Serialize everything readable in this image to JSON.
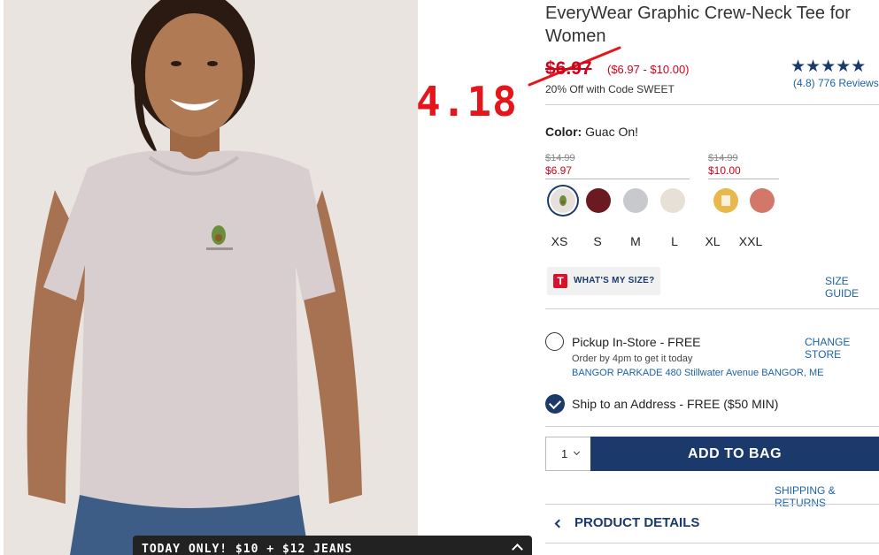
{
  "product": {
    "title": "EveryWear Graphic Crew-Neck Tee for Women",
    "sale_price": "$6.97",
    "price_range": "($6.97 - $10.00)",
    "promo": "20% Off with Code SWEET",
    "rating_stars": "★★★★★",
    "reviews": "(4.8) 776 Reviews"
  },
  "annotation": {
    "number": "4.18",
    "color": "#e4161b"
  },
  "color": {
    "label": "Color:",
    "value": "Guac On!",
    "groups": [
      {
        "original": "$14.99",
        "sale": "$6.97"
      },
      {
        "original": "$14.99",
        "sale": "$10.00"
      }
    ],
    "swatches": [
      {
        "name": "guac-on",
        "color": "#e6e0dc",
        "selected": true
      },
      {
        "name": "maroon",
        "color": "#6b1a22",
        "selected": false
      },
      {
        "name": "heather-grey",
        "color": "#c8c9cc",
        "selected": false
      },
      {
        "name": "oatmeal",
        "color": "#e7e0d6",
        "selected": false
      },
      {
        "name": "yellow-graphic",
        "color": "#e8b84a",
        "selected": false
      },
      {
        "name": "coral",
        "color": "#d4776b",
        "selected": false
      }
    ]
  },
  "sizes": [
    "XS",
    "S",
    "M",
    "L",
    "XL",
    "XXL"
  ],
  "size_help": {
    "badge": "T",
    "whats_my_size": "WHAT'S MY SIZE?",
    "size_guide": "SIZE GUIDE"
  },
  "fulfillment": {
    "pickup_label": "Pickup In-Store - FREE",
    "change_store": "CHANGE STORE",
    "order_by": "Order by 4pm to get it today",
    "store_address": "BANGOR PARKADE 480 Stillwater Avenue  BANGOR, ME",
    "ship_label": "Ship to an Address - FREE ($50 MIN)"
  },
  "cart": {
    "quantity": "1",
    "add_to_bag": "ADD TO BAG",
    "shipping_returns": "SHIPPING & RETURNS"
  },
  "product_details": "PRODUCT DETAILS",
  "promo_banner": "TODAY ONLY! $10 + $12 JEANS",
  "theme": {
    "navy": "#1b3a6b",
    "sale_red": "#d0021b",
    "link_blue": "#1b62a8"
  }
}
